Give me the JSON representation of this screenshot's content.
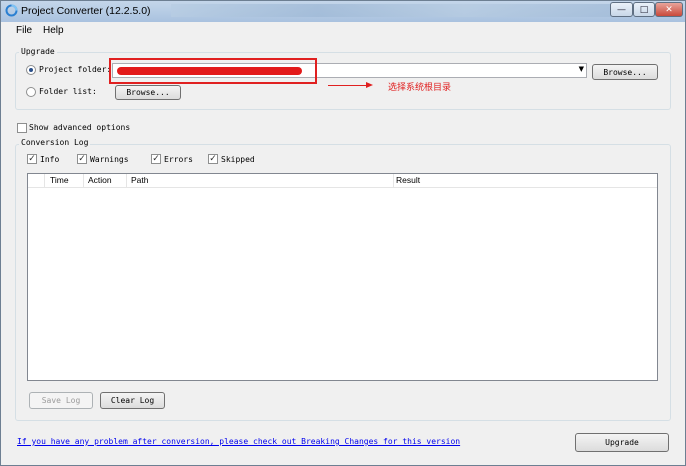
{
  "window": {
    "title": "Project Converter (12.2.5.0)",
    "controls": {
      "minimize": "—",
      "maximize": "□",
      "close": "✕"
    }
  },
  "menu": {
    "file": "File",
    "help": "Help"
  },
  "upgrade_group": {
    "label": "Upgrade",
    "project_folder_label": "Project folder:",
    "project_folder_selected": true,
    "project_folder_value": "",
    "folder_list_label": "Folder list:",
    "browse1": "Browse...",
    "browse2": "Browse..."
  },
  "annotation": {
    "text": "选择系统根目录",
    "color": "#e02020"
  },
  "show_advanced_options": "Show advanced options",
  "log_group": {
    "label": "Conversion Log",
    "filters": [
      {
        "label": "Info",
        "checked": true
      },
      {
        "label": "Warnings",
        "checked": true
      },
      {
        "label": "Errors",
        "checked": true
      },
      {
        "label": "Skipped",
        "checked": true
      }
    ],
    "columns": [
      "Time",
      "Action",
      "Path",
      "Result"
    ],
    "rows": [],
    "save_log": "Save Log",
    "clear_log": "Clear Log"
  },
  "footer": {
    "help_link": "If you have any problem after conversion, please check out Breaking Changes for this version",
    "upgrade_button": "Upgrade"
  },
  "icons": {
    "app": "converter-icon",
    "checkmark": "✓",
    "dropdown": "▼"
  }
}
